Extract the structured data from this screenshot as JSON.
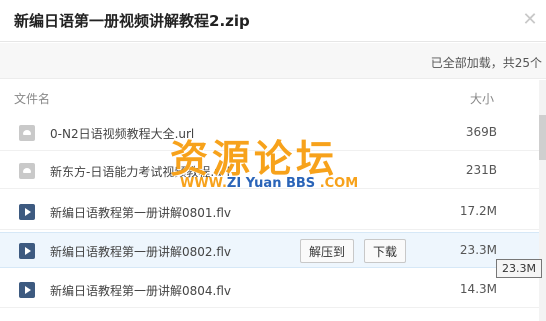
{
  "window": {
    "title": "新编日语第一册视频讲解教程2.zip",
    "close_glyph": "✕"
  },
  "status": {
    "text": "已全部加载，共25个"
  },
  "columns": {
    "name": "文件名",
    "size": "大小"
  },
  "files": [
    {
      "name": "0-N2日语视频教程大全.url",
      "size": "369B",
      "icon": "url-file-icon"
    },
    {
      "name": "新东方-日语能力考试视频教程.url",
      "size": "231B",
      "icon": "url-file-icon"
    },
    {
      "name": "新编日语教程第一册讲解0801.flv",
      "size": "17.2M",
      "icon": "video-file-icon"
    },
    {
      "name": "新编日语教程第一册讲解0802.flv",
      "size": "23.3M",
      "icon": "video-file-icon"
    },
    {
      "name": "新编日语教程第一册讲解0804.flv",
      "size": "14.3M",
      "icon": "video-file-icon"
    }
  ],
  "row_actions": {
    "extract": "解压到",
    "download": "下载"
  },
  "tooltip": "23.3M",
  "watermark": {
    "main": "资源论坛",
    "sub_www": "WWW.",
    "sub_zi": "ZI",
    "sub_yuan": " Yuan ",
    "sub_bbs": "BBS",
    "sub_com": " .COM"
  }
}
